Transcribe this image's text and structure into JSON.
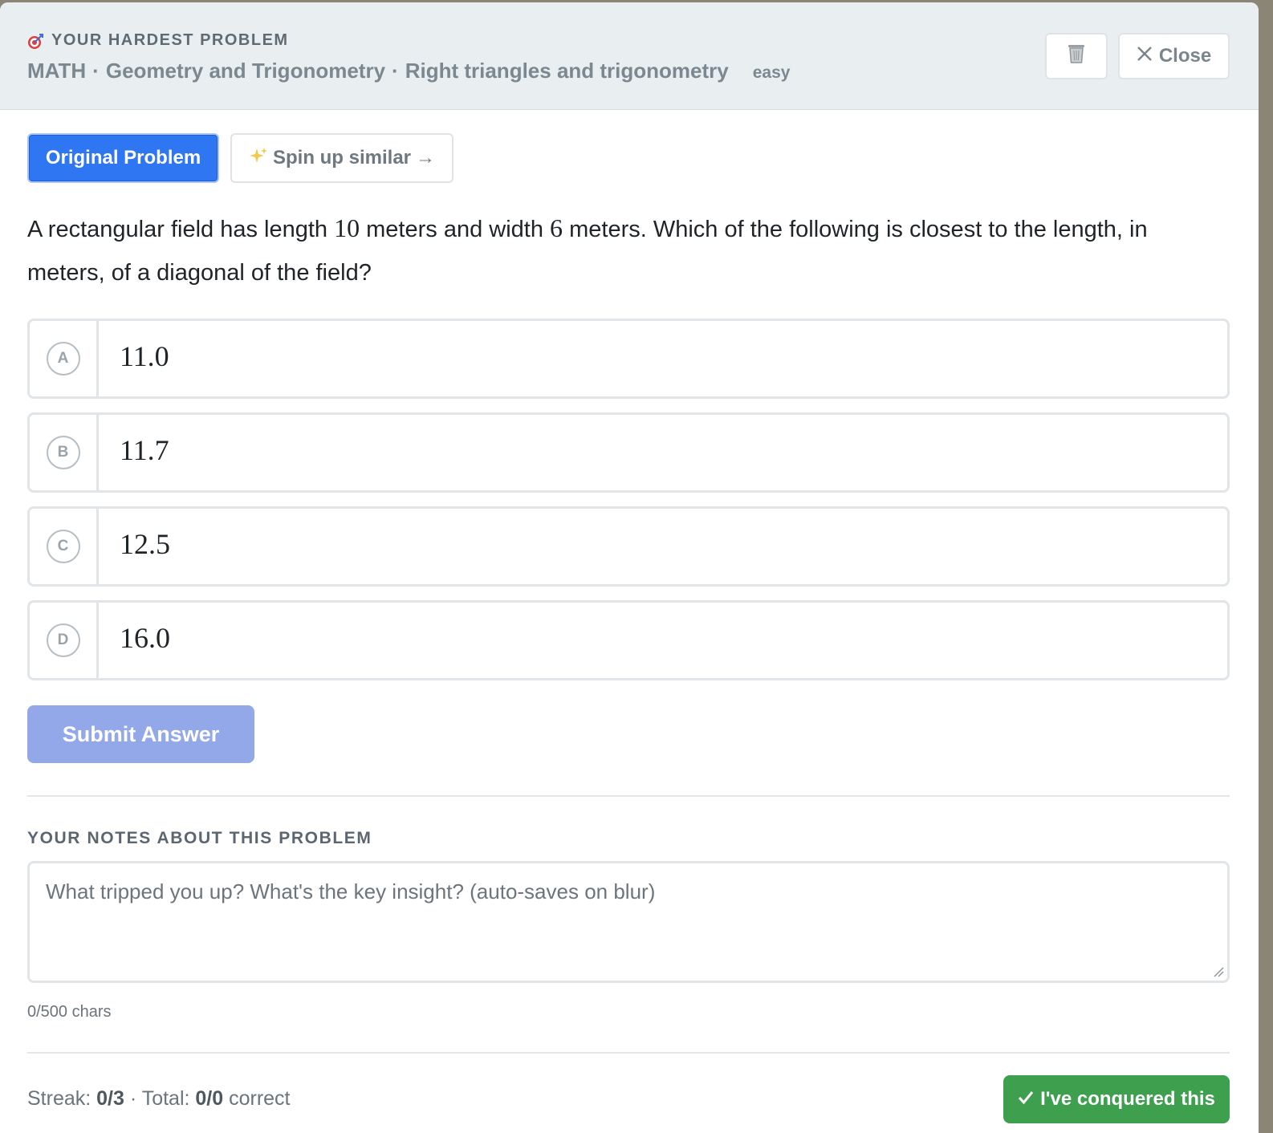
{
  "header": {
    "eyebrow": "YOUR HARDEST PROBLEM",
    "subject": "MATH",
    "domain": "Geometry and Trigonometry",
    "skill": "Right triangles and trigonometry",
    "separator": "·",
    "difficulty": "easy",
    "close_label": "Close",
    "icons": {
      "eyebrow": "target-icon",
      "trash": "trash-icon",
      "close": "x-icon"
    }
  },
  "tabs": {
    "original": "Original Problem",
    "similar": "Spin up similar",
    "similar_icon": "sparkles-icon",
    "similar_arrow": "→"
  },
  "question": {
    "part1": "A rectangular field has length ",
    "length": "10",
    "part2": " meters and width ",
    "width": "6",
    "part3": " meters. Which of the following is closest to the length, in meters, of a diagonal of the field?"
  },
  "choices": [
    {
      "letter": "A",
      "value": "11.0"
    },
    {
      "letter": "B",
      "value": "11.7"
    },
    {
      "letter": "C",
      "value": "12.5"
    },
    {
      "letter": "D",
      "value": "16.0"
    }
  ],
  "submit_label": "Submit Answer",
  "notes": {
    "label": "YOUR NOTES ABOUT THIS PROBLEM",
    "placeholder": "What tripped you up? What's the key insight? (auto-saves on blur)",
    "value": "",
    "char_count": "0/500 chars"
  },
  "footer": {
    "streak_label": "Streak: ",
    "streak_value": "0/3",
    "sep": " · ",
    "total_label": "Total: ",
    "total_value": "0/0",
    "total_suffix": " correct",
    "conquered_label": "I've conquered this",
    "conquered_icon": "check-icon"
  },
  "colors": {
    "primary": "#2f77f2",
    "submit_disabled": "#93a8e8",
    "success": "#3ea04f",
    "header_bg": "#e9eef0"
  }
}
